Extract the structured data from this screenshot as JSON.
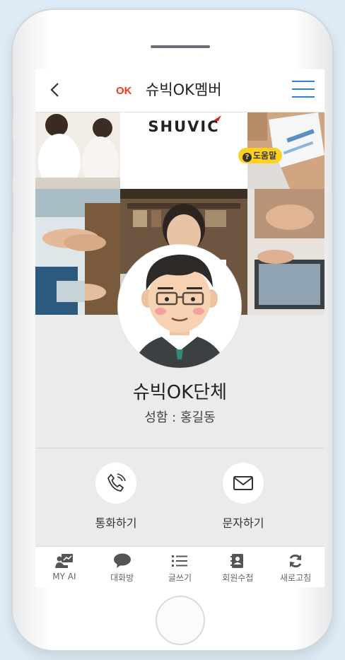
{
  "header": {
    "back_icon": "chevron-left-icon",
    "logo_text": "OK",
    "title": "슈빅OK멤버",
    "menu_icon": "hamburger-icon"
  },
  "banner": {
    "brand_text": "SHUVIC",
    "help_label": "도움말"
  },
  "profile": {
    "org_name": "슈빅OK단체",
    "person_name": "성함 : 홍길동"
  },
  "actions": [
    {
      "label": "통화하기",
      "icon": "phone-icon"
    },
    {
      "label": "문자하기",
      "icon": "envelope-icon"
    }
  ],
  "tabs": [
    {
      "label": "MY AI",
      "icon": "ai-presenter-icon"
    },
    {
      "label": "대화방",
      "icon": "chat-bubble-icon"
    },
    {
      "label": "글쓰기",
      "icon": "list-icon"
    },
    {
      "label": "회원수첩",
      "icon": "contact-book-icon"
    },
    {
      "label": "새로고침",
      "icon": "refresh-icon"
    }
  ],
  "colors": {
    "accent": "#2f7fd6",
    "logo_red": "#f03a2a",
    "help_badge": "#ffd11c",
    "screen_bg": "#ebebeb"
  }
}
